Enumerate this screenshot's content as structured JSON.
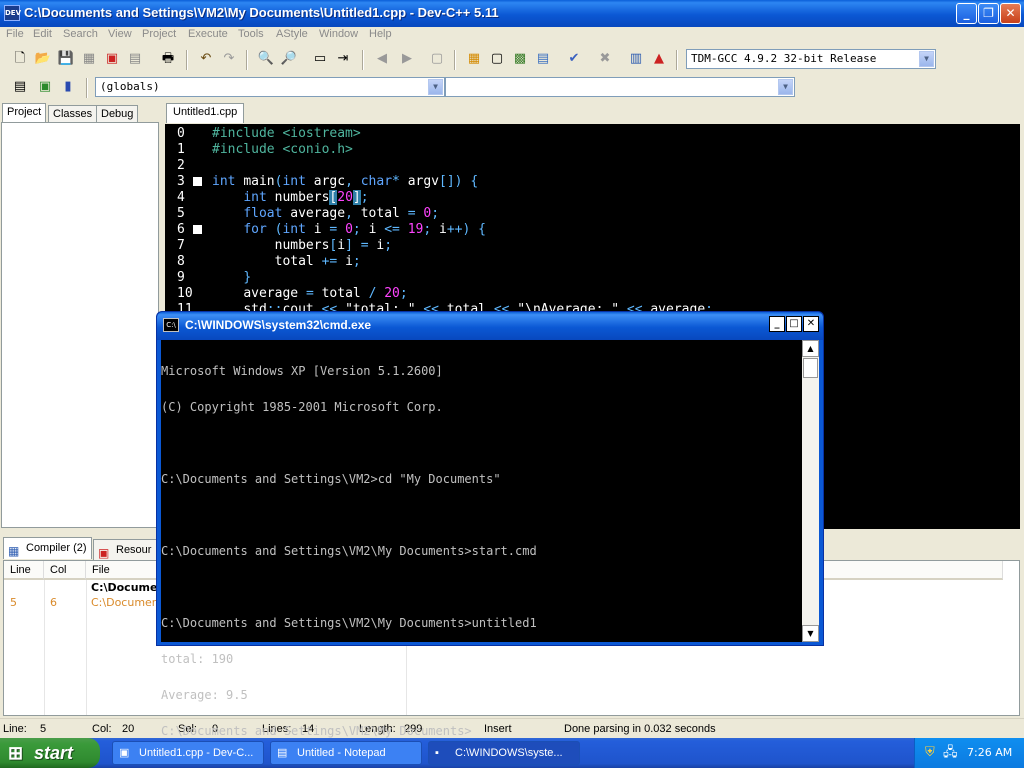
{
  "window": {
    "title": "C:\\Documents and Settings\\VM2\\My Documents\\Untitled1.cpp - Dev-C++ 5.11",
    "icon_label": "DEV"
  },
  "menu": [
    "File",
    "Edit",
    "Search",
    "View",
    "Project",
    "Execute",
    "Tools",
    "AStyle",
    "Window",
    "Help"
  ],
  "toolbar": {
    "compiler_select": "TDM-GCC 4.9.2 32-bit Release",
    "scope_select": "(globals)",
    "function_select": ""
  },
  "left_tabs": [
    "Project",
    "Classes",
    "Debug"
  ],
  "editor": {
    "tab": "Untitled1.cpp",
    "line_numbers": [
      "0",
      "1",
      "2",
      "3",
      "4",
      "5",
      "6",
      "7",
      "8",
      "9",
      "10",
      "11"
    ]
  },
  "bottom": {
    "tabs": [
      "Compiler (2)",
      "Resour"
    ],
    "columns": [
      "Line",
      "Col",
      "File"
    ],
    "rows": [
      {
        "line": "",
        "col": "",
        "file": "C:\\Docume"
      },
      {
        "line": "5",
        "col": "6",
        "file": "C:\\Document"
      }
    ]
  },
  "status": {
    "line_label": "Line:",
    "line": "5",
    "col_label": "Col:",
    "col": "20",
    "sel_label": "Sel:",
    "sel": "0",
    "lines_label": "Lines:",
    "lines": "14",
    "length_label": "Length:",
    "length": "299",
    "mode": "Insert",
    "message": "Done parsing in 0.032 seconds"
  },
  "cmd": {
    "title": "C:\\WINDOWS\\system32\\cmd.exe",
    "lines": [
      "Microsoft Windows XP [Version 5.1.2600]",
      "(C) Copyright 1985-2001 Microsoft Corp.",
      "",
      "C:\\Documents and Settings\\VM2>cd \"My Documents\"",
      "",
      "C:\\Documents and Settings\\VM2\\My Documents>start.cmd",
      "",
      "C:\\Documents and Settings\\VM2\\My Documents>untitled1",
      "total: 190",
      "Average: 9.5",
      "C:\\Documents and Settings\\VM2\\My Documents>"
    ]
  },
  "taskbar": {
    "start": "start",
    "items": [
      "Untitled1.cpp - Dev-C...",
      "Untitled - Notepad",
      "C:\\WINDOWS\\syste..."
    ],
    "clock": "7:26 AM"
  }
}
